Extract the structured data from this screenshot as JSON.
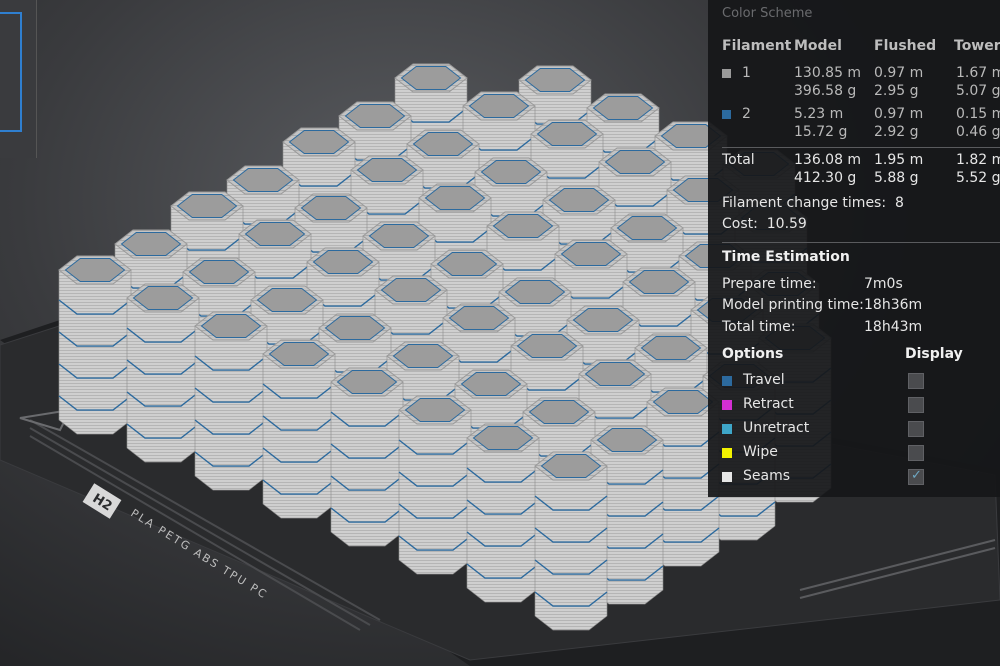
{
  "panel": {
    "color_scheme_title": "Color Scheme",
    "headers": {
      "filament": "Filament",
      "model": "Model",
      "flushed": "Flushed",
      "tower": "Tower"
    },
    "rows": [
      {
        "id": "1",
        "color": "#9a9a9a",
        "model": [
          "130.85 m",
          "396.58 g"
        ],
        "flushed": [
          "0.97 m",
          "2.95 g"
        ],
        "tower": [
          "1.67 m",
          "5.07 g"
        ]
      },
      {
        "id": "2",
        "color": "#2c6a9e",
        "model": [
          "5.23 m",
          "15.72 g"
        ],
        "flushed": [
          "0.97 m",
          "2.92 g"
        ],
        "tower": [
          "0.15 m",
          "0.46 g"
        ]
      }
    ],
    "total": {
      "label": "Total",
      "model": [
        "136.08 m",
        "412.30 g"
      ],
      "flushed": [
        "1.95 m",
        "5.88 g"
      ],
      "tower": [
        "1.82 m",
        "5.52 g"
      ]
    },
    "filament_change": {
      "label": "Filament change times:",
      "value": "8"
    },
    "cost": {
      "label": "Cost:",
      "value": "10.59"
    },
    "time_estimation": {
      "title": "Time Estimation",
      "prepare": {
        "label": "Prepare time:",
        "value": "7m0s"
      },
      "model_printing": {
        "label": "Model printing time:",
        "value": "18h36m"
      },
      "total": {
        "label": "Total time:",
        "value": "18h43m"
      }
    },
    "options": {
      "title": "Options",
      "display_title": "Display",
      "items": [
        {
          "label": "Travel",
          "color": "#2c6a9e",
          "checked": false
        },
        {
          "label": "Retract",
          "color": "#d42fd4",
          "checked": false
        },
        {
          "label": "Unretract",
          "color": "#3ea6c8",
          "checked": false
        },
        {
          "label": "Wipe",
          "color": "#f2f200",
          "checked": false
        },
        {
          "label": "Seams",
          "color": "#e6e6e6",
          "checked": true
        }
      ]
    }
  },
  "plate": {
    "label": "PLA PETG ABS TPU PC",
    "badge": "H2"
  }
}
